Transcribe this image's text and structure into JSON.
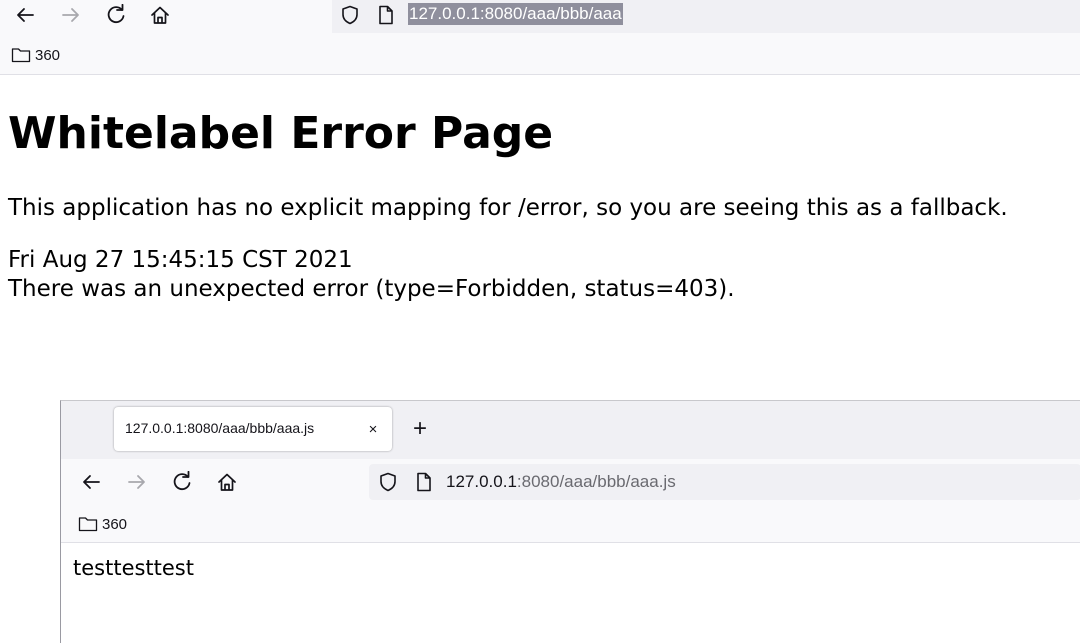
{
  "top_browser": {
    "url": "127.0.0.1:8080/aaa/bbb/aaa",
    "bookmark_label": "360"
  },
  "error_page": {
    "title": "Whitelabel Error Page",
    "message": "This application has no explicit mapping for /error, so you are seeing this as a fallback.",
    "timestamp": "Fri Aug 27 15:45:15 CST 2021",
    "detail": "There was an unexpected error (type=Forbidden, status=403)."
  },
  "inner_browser": {
    "tab_title": "127.0.0.1:8080/aaa/bbb/aaa.js",
    "tab_close": "×",
    "new_tab": "+",
    "url_host": "127.0.0.1",
    "url_path": ":8080/aaa/bbb/aaa.js",
    "bookmark_label": "360",
    "content": "testtesttest"
  },
  "colors": {
    "url_selection": "#8f8f9d",
    "toolbar_bg": "#f9f9fb",
    "urlbar_bg": "#f0f0f4"
  }
}
